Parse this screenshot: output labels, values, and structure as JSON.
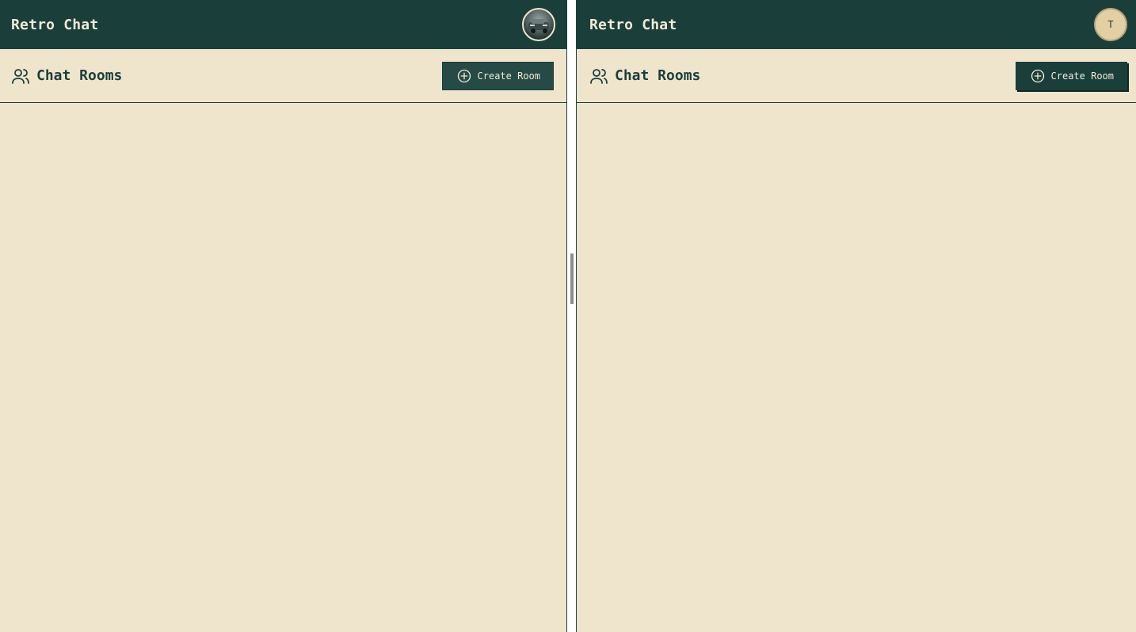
{
  "left": {
    "app_title": "Retro Chat",
    "section_title": "Chat Rooms",
    "create_button_label": "Create Room"
  },
  "right": {
    "app_title": "Retro Chat",
    "avatar_initial": "T",
    "section_title": "Chat Rooms",
    "create_button_label": "Create Room"
  },
  "colors": {
    "header_bg": "#1a3f3b",
    "pane_bg": "#efe5cd",
    "accent_text": "#f3ead3"
  },
  "icons": {
    "section": "users-icon",
    "create": "plus-circle-icon"
  }
}
